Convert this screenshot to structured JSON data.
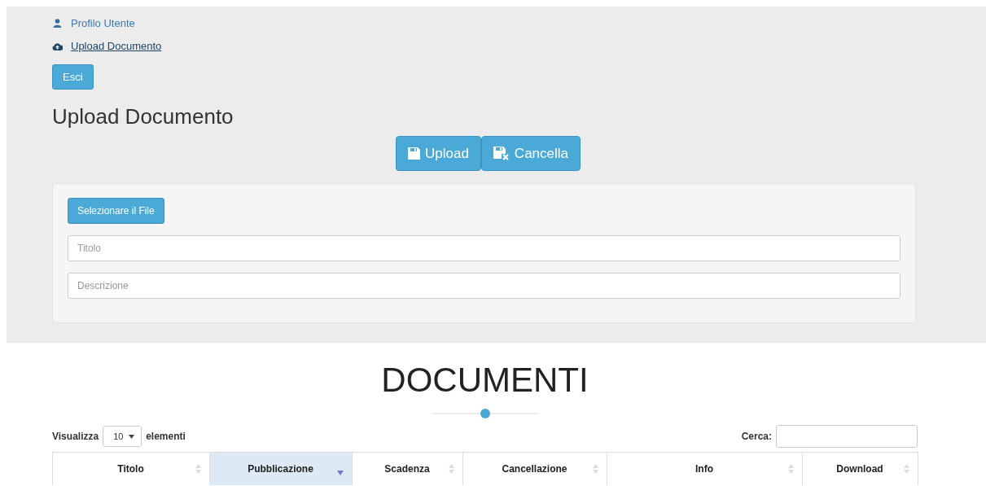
{
  "nav_links": [
    {
      "label": "Profilo Utente",
      "kind": "user",
      "underlined": false
    },
    {
      "label": "Upload Documento",
      "kind": "upload",
      "underlined": true
    }
  ],
  "logout_button": "Esci",
  "heading": "Upload Documento",
  "actions": [
    {
      "label": "Upload",
      "kind": "save"
    },
    {
      "label": "Cancella",
      "kind": "remove"
    }
  ],
  "form": {
    "file_button": "Selezionare il File",
    "fields": [
      {
        "placeholder": "Titolo"
      },
      {
        "placeholder": "Descrizione"
      }
    ]
  },
  "documents": {
    "title": "DOCUMENTI",
    "length_label": "Visualizza",
    "length_value": "10",
    "length_suffix": "elementi",
    "search_label": "Cerca:",
    "columns": [
      {
        "label": "Titolo",
        "selected": false
      },
      {
        "label": "Pubblicazione",
        "selected": true
      },
      {
        "label": "Scadenza",
        "selected": false
      },
      {
        "label": "Cancellazione",
        "selected": false
      },
      {
        "label": "Info",
        "selected": false
      },
      {
        "label": "Download",
        "selected": false
      }
    ]
  }
}
